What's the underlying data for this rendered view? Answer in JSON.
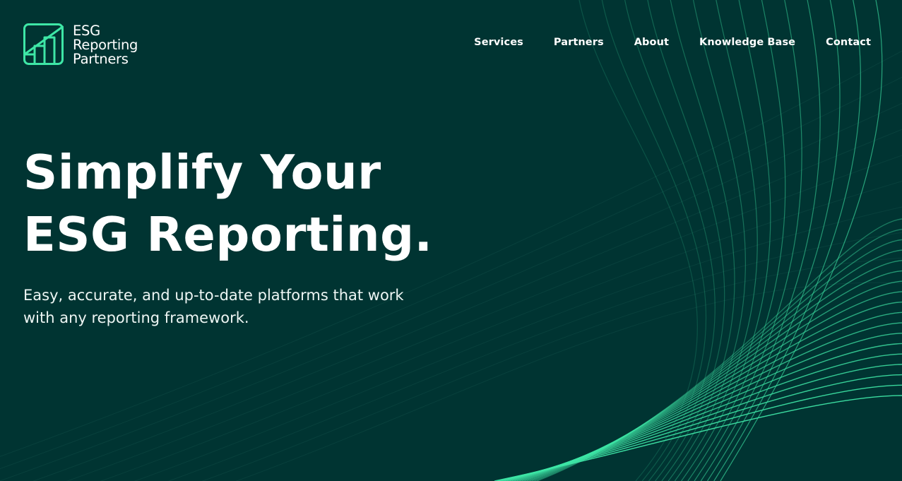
{
  "brand": {
    "line1": "ESG",
    "line2": "Reporting",
    "line3": "Partners",
    "accent_color": "#3ee6a6",
    "background_color": "#003432"
  },
  "nav": {
    "items": [
      {
        "label": "Services",
        "icon": ""
      },
      {
        "label": "Partners",
        "icon": ""
      },
      {
        "label": "About",
        "icon": ""
      },
      {
        "label": "Knowledge Base",
        "icon": ""
      },
      {
        "label": "Contact",
        "icon": ""
      }
    ]
  },
  "hero": {
    "title_line1": "Simplify Your",
    "title_line2": "ESG Reporting.",
    "subtitle": "Easy, accurate, and up-to-date platforms that work with any reporting framework."
  },
  "decoration": {
    "wave_icon": "wave-lines-decoration"
  }
}
